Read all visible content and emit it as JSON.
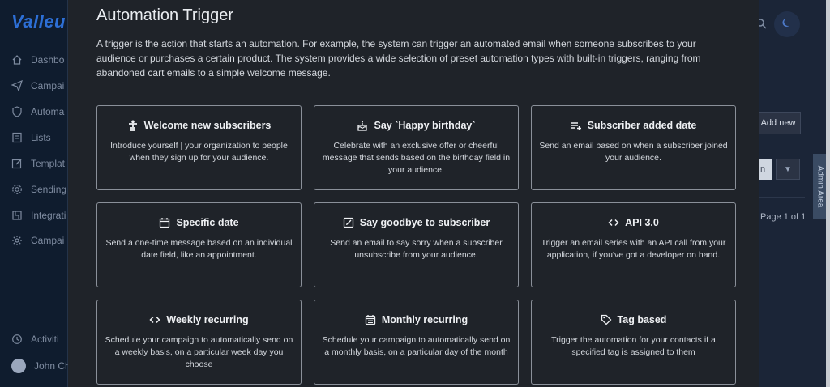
{
  "background": {
    "logo": "Valleu",
    "nav": [
      {
        "label": "Dashbo",
        "icon": "home-icon"
      },
      {
        "label": "Campai",
        "icon": "send-icon"
      },
      {
        "label": "Automa",
        "icon": "shield-icon"
      },
      {
        "label": "Lists",
        "icon": "list-icon"
      },
      {
        "label": "Templat",
        "icon": "edit-icon"
      },
      {
        "label": "Sending",
        "icon": "settings-icon"
      },
      {
        "label": "Integrati",
        "icon": "plug-icon"
      },
      {
        "label": "Campai",
        "icon": "gear-icon"
      }
    ],
    "activities_label": "Activiti",
    "user_label": "John Ch",
    "add_new": "Add new",
    "page_label": "Page 1 of 1",
    "admin_area": "Admin Area",
    "btn_n": "n"
  },
  "modal": {
    "title": "Automation Trigger",
    "description": "A trigger is the action that starts an automation. For example, the system can trigger an automated email when someone subscribes to your audience or purchases a certain product. The system provides a wide selection of preset automation types with built-in triggers, ranging from abandoned cart emails to a simple welcome message.",
    "cards": [
      {
        "title": "Welcome new subscribers",
        "icon": "person-icon",
        "desc": "Introduce yourself | your organization to people when they sign up for your audience."
      },
      {
        "title": "Say `Happy birthday`",
        "icon": "cake-icon",
        "desc": "Celebrate with an exclusive offer or cheerful message that sends based on the birthday field in your audience."
      },
      {
        "title": "Subscriber added date",
        "icon": "list-add-icon",
        "desc": "Send an email based on when a subscriber joined your audience."
      },
      {
        "title": "Specific date",
        "icon": "calendar-icon",
        "desc": "Send a one-time message based on an individual date field, like an appointment."
      },
      {
        "title": "Say goodbye to subscriber",
        "icon": "edit-box-icon",
        "desc": "Send an email to say sorry when a subscriber unsubscribe from your audience."
      },
      {
        "title": "API 3.0",
        "icon": "code-icon",
        "desc": "Trigger an email series with an API call from your application, if you've got a developer on hand."
      },
      {
        "title": "Weekly recurring",
        "icon": "code-icon",
        "desc": "Schedule your campaign to automatically send on a weekly basis, on a particular week day you choose"
      },
      {
        "title": "Monthly recurring",
        "icon": "calendar-icon",
        "desc": "Schedule your campaign to automatically send on a monthly basis, on a particular day of the month"
      },
      {
        "title": "Tag based",
        "icon": "tag-icon",
        "desc": "Trigger the automation for your contacts if a specified tag is assigned to them"
      }
    ]
  }
}
